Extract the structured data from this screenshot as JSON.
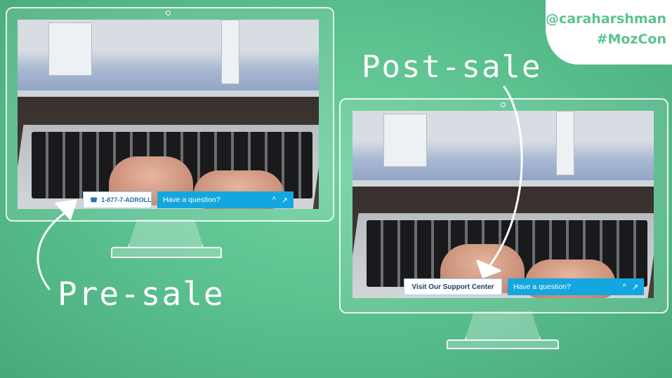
{
  "header": {
    "handle": "@caraharshman",
    "hashtag": "#MozCon"
  },
  "labels": {
    "pre_sale": "Pre-sale",
    "post_sale": "Post-sale"
  },
  "pre_sale_widget": {
    "phone_icon": "phone-icon",
    "phone_label": "1-877-7-ADROLL",
    "question_label": "Have a question?",
    "controls": [
      "^",
      "↗"
    ]
  },
  "post_sale_widget": {
    "support_label": "Visit Our Support Center",
    "question_label": "Have a question?",
    "controls": [
      "^",
      "↗"
    ]
  },
  "colors": {
    "background": "#5cc290",
    "accent": "#14a7df",
    "handle_text": "#5cc290"
  }
}
